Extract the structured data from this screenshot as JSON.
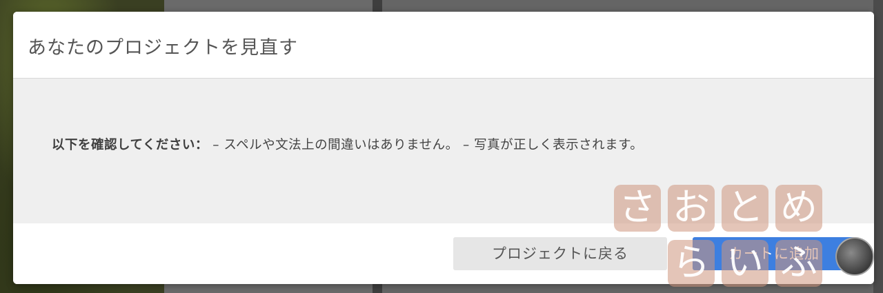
{
  "modal": {
    "title": "あなたのプロジェクトを見直す",
    "message_strong": "以下を確認してください：",
    "message_rest": " – スペルや文法上の間違いはありません。 – 写真が正しく表示されます。",
    "buttons": {
      "back_label": "プロジェクトに戻る",
      "add_label": "カートに追加"
    }
  },
  "watermark": {
    "row1": [
      "さ",
      "お",
      "と",
      "め"
    ],
    "row2": [
      "ら",
      "い",
      "ふ"
    ]
  },
  "colors": {
    "primary_button": "#3d7fe0",
    "secondary_button": "#e6e6e6",
    "body_background": "#efefef",
    "watermark_tile": "#cd967d"
  }
}
